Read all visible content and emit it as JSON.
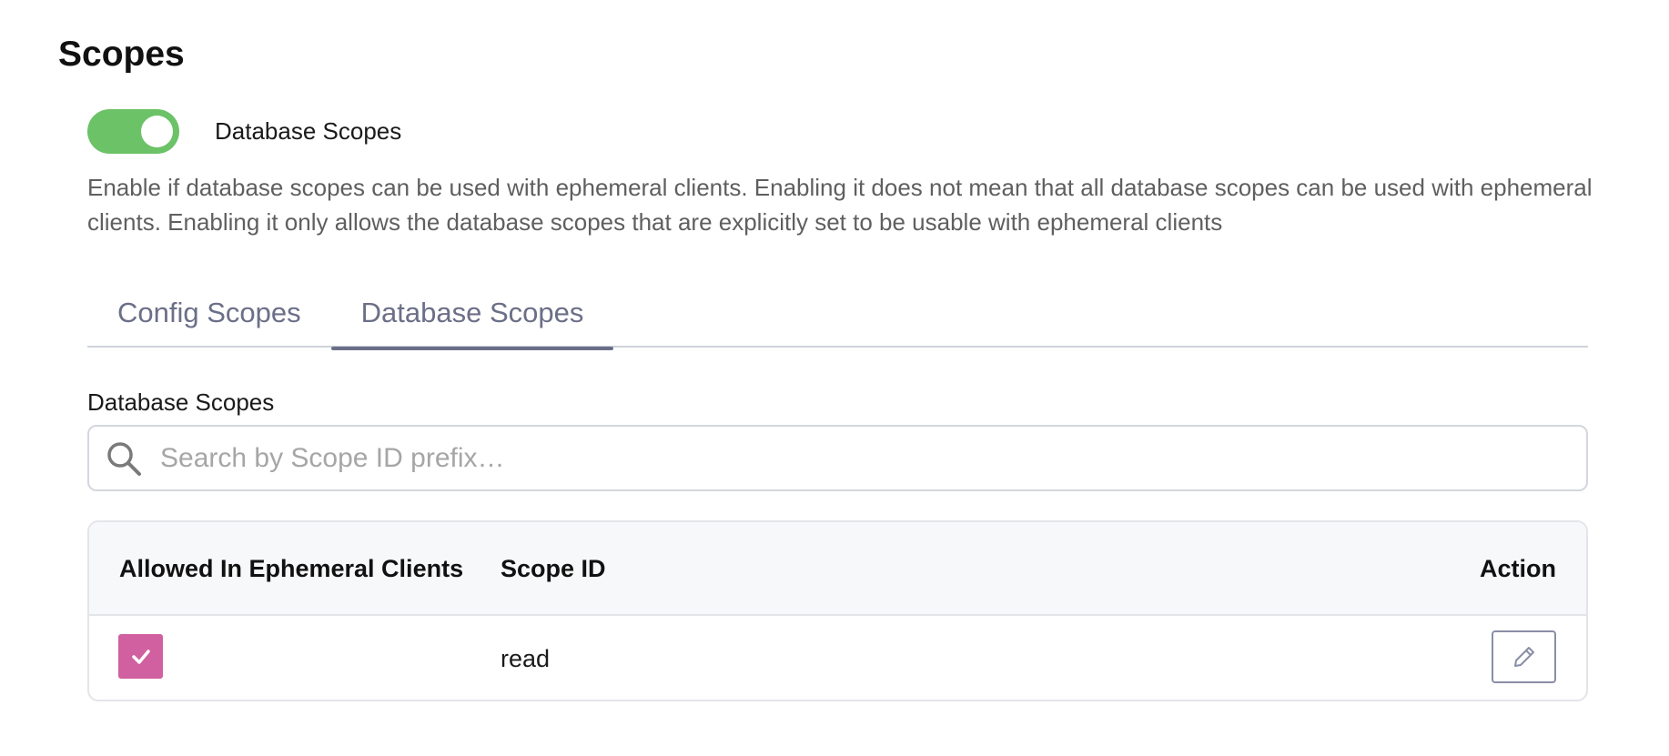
{
  "page": {
    "title": "Scopes"
  },
  "toggle": {
    "label": "Database Scopes",
    "enabled": true,
    "on_color": "#6cc267"
  },
  "description": "Enable if database scopes can be used with ephemeral clients. Enabling it does not mean that all database scopes can be used with ephemeral clients. Enabling it only allows the database scopes that are explicitly set to be usable with ephemeral clients",
  "tabs": [
    {
      "label": "Config Scopes",
      "active": false
    },
    {
      "label": "Database Scopes",
      "active": true
    }
  ],
  "section": {
    "label": "Database Scopes"
  },
  "search": {
    "placeholder": "Search by Scope ID prefix…",
    "value": "",
    "icon": "search-icon"
  },
  "table": {
    "headers": [
      "Allowed In Ephemeral Clients",
      "Scope ID",
      "Action"
    ],
    "rows": [
      {
        "allowed": true,
        "scope_id": "read",
        "action_icon": "pencil-icon"
      }
    ]
  },
  "colors": {
    "accent_checkbox": "#d0609f",
    "tab_text": "#6b6f87"
  }
}
